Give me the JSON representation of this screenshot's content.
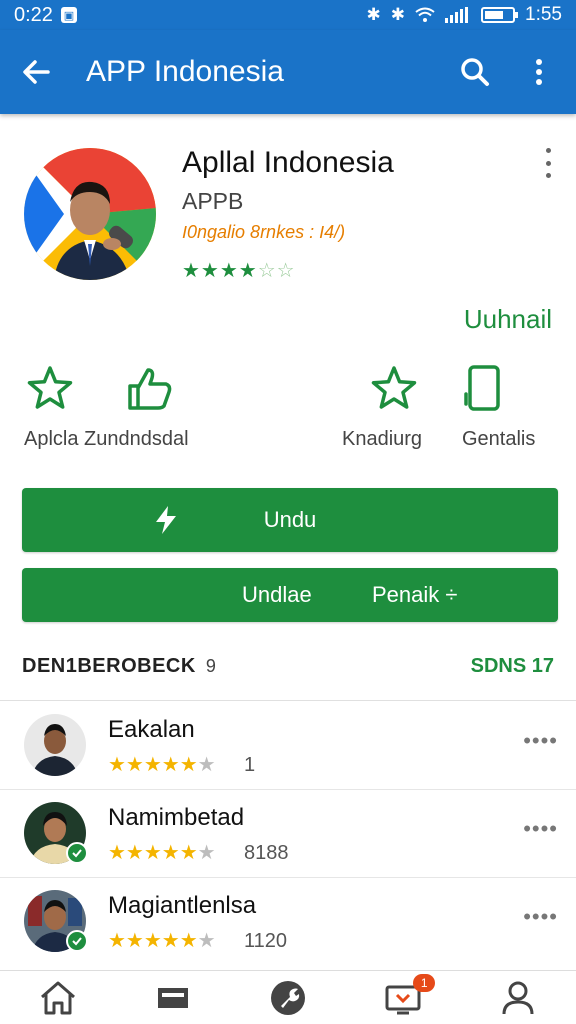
{
  "status_bar": {
    "time": "0:22",
    "clock": "1:55"
  },
  "app_bar": {
    "title": "APP Indonesia"
  },
  "app": {
    "name": "Apllal Indonesia",
    "developer": "APPB",
    "tagline": "Ι0ngalio 8rnkes : Ι4/)",
    "rating_stars": 4.5,
    "uninstall_label": "Uuhnail"
  },
  "quick_actions": [
    {
      "label": "Aplcla Zundndsdal",
      "icon": "star-outline-icon"
    },
    {
      "label": "",
      "icon": "thumbs-up-outline-icon"
    },
    {
      "label": "Knadiurg",
      "icon": "star-outline-icon"
    },
    {
      "label": "Gentalis",
      "icon": "phone-outline-icon"
    }
  ],
  "buttons": {
    "primary_label": "Undu",
    "secondary_left": "Undlae",
    "secondary_right": "Penaik ÷"
  },
  "reviews_section": {
    "label": "DEN1BEROBECK",
    "badge": "9",
    "count": "SDNS 17"
  },
  "reviews": [
    {
      "name": "Eakalan",
      "rating": 4,
      "count": "1",
      "verified": false
    },
    {
      "name": "Namimbetad",
      "rating": 4,
      "count": "8188",
      "verified": true
    },
    {
      "name": "Magiantlenlsa",
      "rating": 4,
      "count": "1120",
      "verified": true
    }
  ],
  "bottom_nav": {
    "badge": "1"
  },
  "colors": {
    "primary": "#1a73c8",
    "accent": "#1e8e3e",
    "star": "#f4b400",
    "tagline": "#e67e00"
  }
}
